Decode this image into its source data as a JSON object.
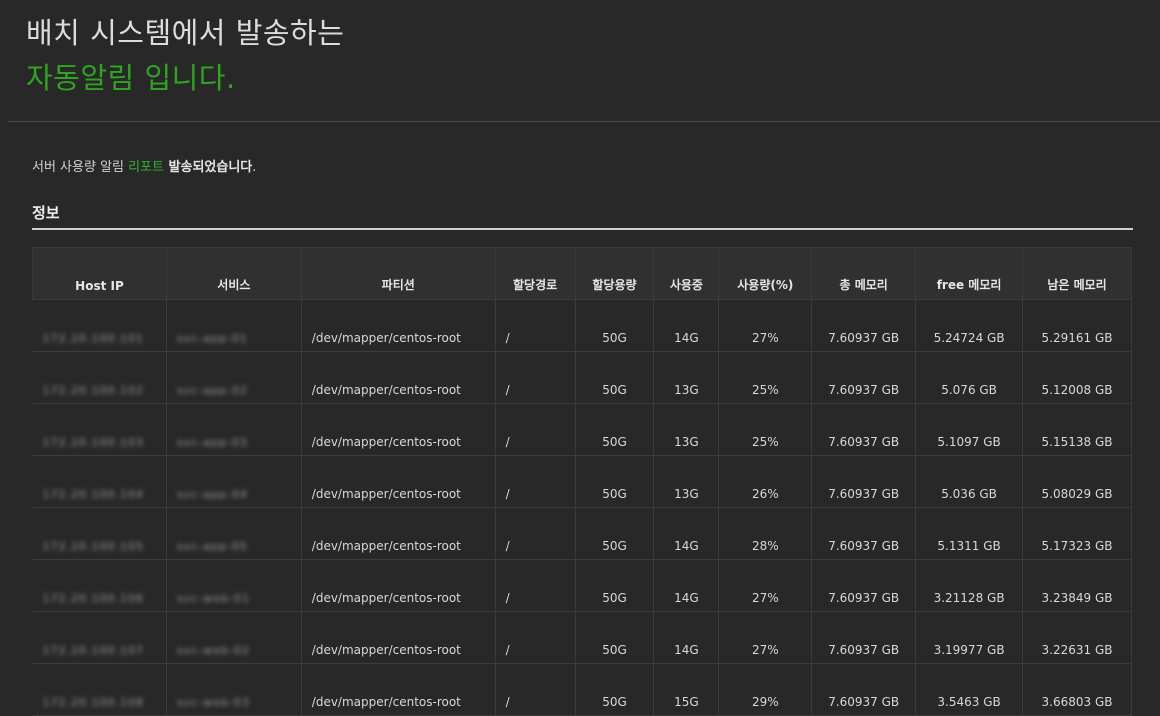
{
  "header": {
    "line1": "배치 시스템에서 발송하는",
    "line2": "자동알림 입니다."
  },
  "intro": {
    "prefix": "서버 사용량 알림 ",
    "accent": "리포트",
    "suffix": " 발송되었습니다",
    "dot": "."
  },
  "section": {
    "title": "정보"
  },
  "table": {
    "columns": [
      "Host IP",
      "서비스",
      "파티션",
      "할당경로",
      "할당용량",
      "사용중",
      "사용량(%)",
      "총 메모리",
      "free 메모리",
      "남은 메모리"
    ],
    "rows": [
      {
        "ip": "172.20.100.101",
        "service": "svc-app-01",
        "partition": "/dev/mapper/centos-root",
        "path": "/",
        "alloc": "50G",
        "used": "14G",
        "pct": "27%",
        "total": "7.60937 GB",
        "free": "5.24724 GB",
        "remain": "5.29161 GB"
      },
      {
        "ip": "172.20.100.102",
        "service": "svc-app-02",
        "partition": "/dev/mapper/centos-root",
        "path": "/",
        "alloc": "50G",
        "used": "13G",
        "pct": "25%",
        "total": "7.60937 GB",
        "free": "5.076 GB",
        "remain": "5.12008 GB"
      },
      {
        "ip": "172.20.100.103",
        "service": "svc-app-03",
        "partition": "/dev/mapper/centos-root",
        "path": "/",
        "alloc": "50G",
        "used": "13G",
        "pct": "25%",
        "total": "7.60937 GB",
        "free": "5.1097 GB",
        "remain": "5.15138 GB"
      },
      {
        "ip": "172.20.100.104",
        "service": "svc-app-04",
        "partition": "/dev/mapper/centos-root",
        "path": "/",
        "alloc": "50G",
        "used": "13G",
        "pct": "26%",
        "total": "7.60937 GB",
        "free": "5.036 GB",
        "remain": "5.08029 GB"
      },
      {
        "ip": "172.20.100.105",
        "service": "svc-app-05",
        "partition": "/dev/mapper/centos-root",
        "path": "/",
        "alloc": "50G",
        "used": "14G",
        "pct": "28%",
        "total": "7.60937 GB",
        "free": "5.1311 GB",
        "remain": "5.17323 GB"
      },
      {
        "ip": "172.20.100.106",
        "service": "svc-web-01",
        "partition": "/dev/mapper/centos-root",
        "path": "/",
        "alloc": "50G",
        "used": "14G",
        "pct": "27%",
        "total": "7.60937 GB",
        "free": "3.21128 GB",
        "remain": "3.23849 GB"
      },
      {
        "ip": "172.20.100.107",
        "service": "svc-web-02",
        "partition": "/dev/mapper/centos-root",
        "path": "/",
        "alloc": "50G",
        "used": "14G",
        "pct": "27%",
        "total": "7.60937 GB",
        "free": "3.19977 GB",
        "remain": "3.22631 GB"
      },
      {
        "ip": "172.20.100.108",
        "service": "svc-web-03",
        "partition": "/dev/mapper/centos-root",
        "path": "/",
        "alloc": "50G",
        "used": "15G",
        "pct": "29%",
        "total": "7.60937 GB",
        "free": "3.5463 GB",
        "remain": "3.66803 GB"
      }
    ]
  }
}
